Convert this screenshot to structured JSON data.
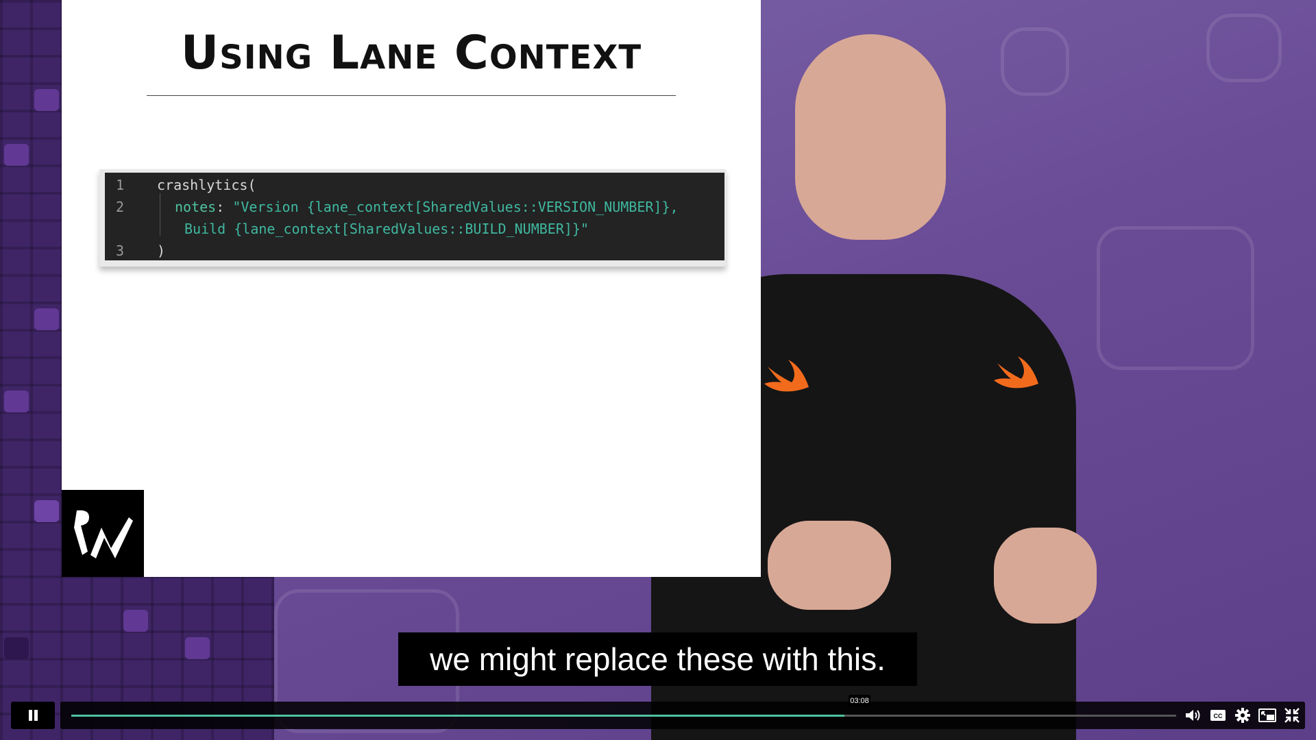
{
  "slide": {
    "title": "Using Lane Context",
    "code_lines": [
      {
        "num": "1",
        "text": "crashlytics("
      },
      {
        "num": "2",
        "key": "notes",
        "sep": ": ",
        "str": "\"Version {lane_context[SharedValues::VERSION_NUMBER]},"
      },
      {
        "num": "",
        "str": "Build {lane_context[SharedValues::BUILD_NUMBER]}\""
      },
      {
        "num": "3",
        "text": ")"
      }
    ]
  },
  "caption": "we might replace these with this.",
  "player": {
    "timestamp": "03:08",
    "progress_fraction": 0.7,
    "icons": [
      "pause-icon",
      "volume-icon",
      "closed-captions-icon",
      "settings-gear-icon",
      "picture-in-picture-icon",
      "exit-fullscreen-icon"
    ],
    "accent_color": "#4fc3a1"
  }
}
